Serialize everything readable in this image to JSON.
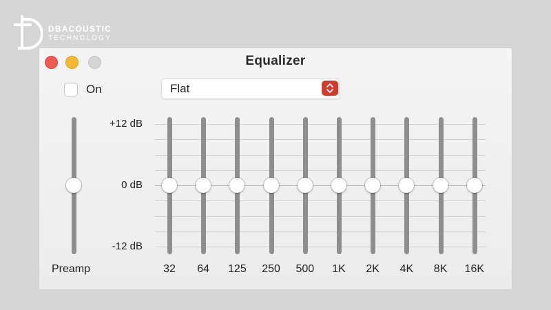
{
  "logo": {
    "line1": "DBACOUSTIC",
    "line2": "TECHNOLOGY"
  },
  "window": {
    "title": "Equalizer"
  },
  "on_toggle": {
    "label": "On",
    "checked": false
  },
  "preset": {
    "selected": "Flat"
  },
  "db_scale": {
    "top": "+12 dB",
    "middle": "0 dB",
    "bottom": "-12 dB"
  },
  "preamp": {
    "label": "Preamp",
    "value_db": 0
  },
  "bands": [
    {
      "label": "32",
      "value_db": 0
    },
    {
      "label": "64",
      "value_db": 0
    },
    {
      "label": "125",
      "value_db": 0
    },
    {
      "label": "250",
      "value_db": 0
    },
    {
      "label": "500",
      "value_db": 0
    },
    {
      "label": "1K",
      "value_db": 0
    },
    {
      "label": "2K",
      "value_db": 0
    },
    {
      "label": "4K",
      "value_db": 0
    },
    {
      "label": "8K",
      "value_db": 0
    },
    {
      "label": "16K",
      "value_db": 0
    }
  ],
  "colors": {
    "close": "#ee5b52",
    "minimize": "#f5b82f",
    "maximize": "#d5d5d5",
    "dropdown_accent": "#d23a2f",
    "track": "#8e8e8e"
  }
}
